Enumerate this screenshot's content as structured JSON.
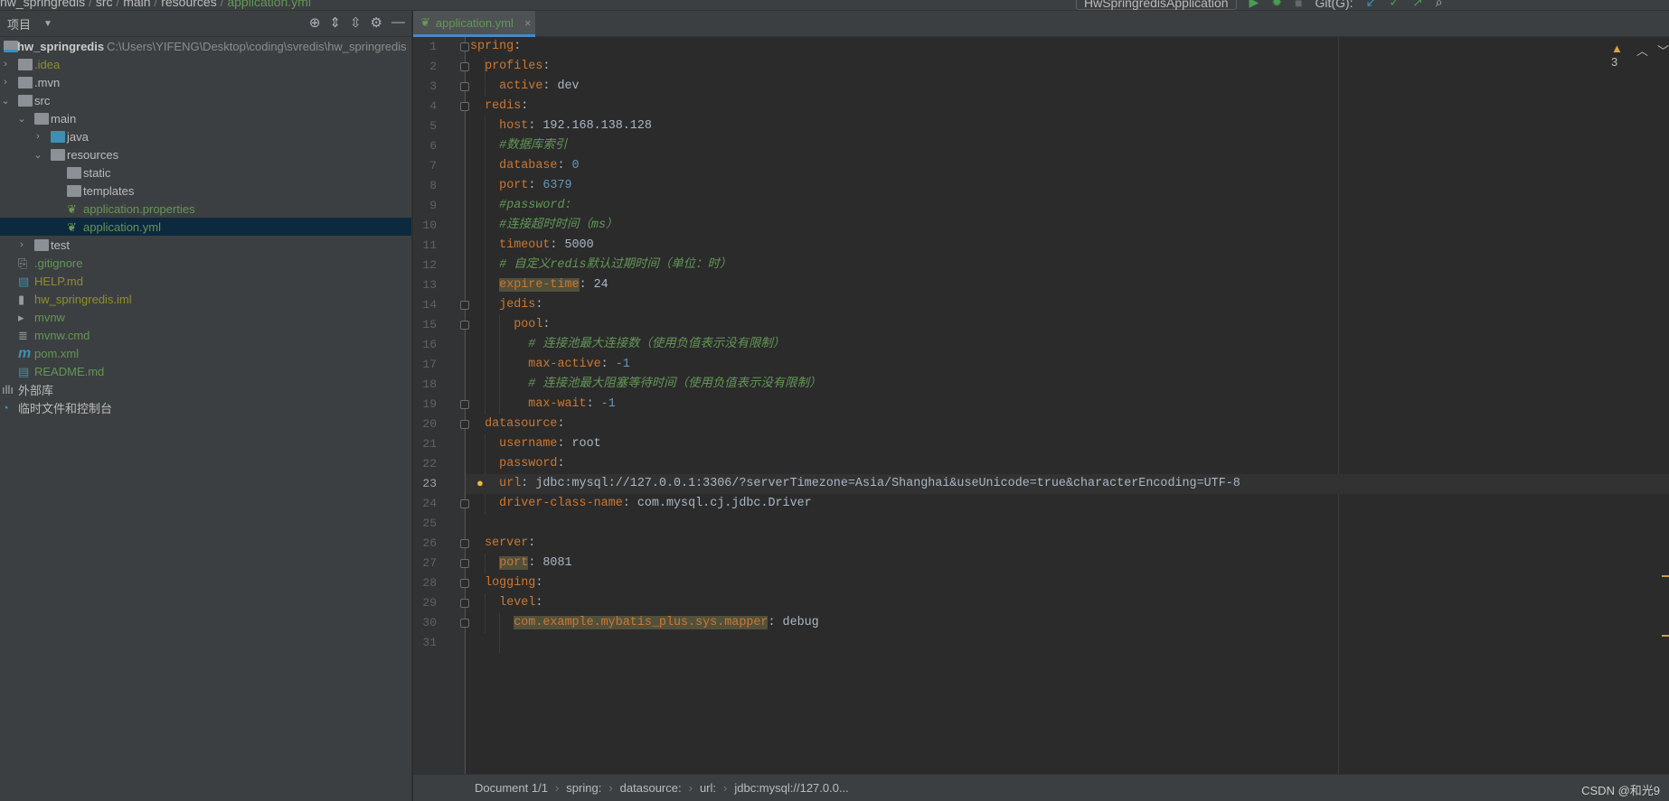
{
  "topbar": {
    "breadcrumb": [
      "hw_springredis",
      "src",
      "main",
      "resources",
      "application.yml"
    ],
    "run_config": "HwSpringredisApplication",
    "git_label": "Git(G):"
  },
  "project": {
    "title": "项目",
    "root_name": "hw_springredis",
    "root_path": "C:\\Users\\YIFENG\\Desktop\\coding\\svredis\\hw_springredis",
    "items": [
      {
        "label": ".idea",
        "depth": 0,
        "chev": ">",
        "icon": "folder-icon",
        "color": "olive"
      },
      {
        "label": ".mvn",
        "depth": 0,
        "chev": ">",
        "icon": "folder-icon",
        "color": "def"
      },
      {
        "label": "src",
        "depth": 0,
        "chev": "v",
        "icon": "folder-icon",
        "color": "def"
      },
      {
        "label": "main",
        "depth": 1,
        "chev": "v",
        "icon": "folder-icon",
        "color": "def"
      },
      {
        "label": "java",
        "depth": 2,
        "chev": ">",
        "icon": "source-folder-icon",
        "color": "def"
      },
      {
        "label": "resources",
        "depth": 2,
        "chev": "v",
        "icon": "resources-folder-icon",
        "color": "def"
      },
      {
        "label": "static",
        "depth": 3,
        "chev": "",
        "icon": "folder-icon",
        "color": "def"
      },
      {
        "label": "templates",
        "depth": 3,
        "chev": "",
        "icon": "folder-icon",
        "color": "def"
      },
      {
        "label": "application.properties",
        "depth": 3,
        "chev": "",
        "icon": "spring-config-icon",
        "color": "green"
      },
      {
        "label": "application.yml",
        "depth": 3,
        "chev": "",
        "icon": "spring-config-icon",
        "color": "green",
        "selected": true
      },
      {
        "label": "test",
        "depth": 1,
        "chev": ">",
        "icon": "folder-icon",
        "color": "def"
      },
      {
        "label": ".gitignore",
        "depth": 0,
        "chev": "",
        "icon": "gitignore-file-icon",
        "color": "green"
      },
      {
        "label": "HELP.md",
        "depth": 0,
        "chev": "",
        "icon": "markdown-file-icon",
        "color": "olive"
      },
      {
        "label": "hw_springredis.iml",
        "depth": 0,
        "chev": "",
        "icon": "iml-file-icon",
        "color": "olive"
      },
      {
        "label": "mvnw",
        "depth": 0,
        "chev": "",
        "icon": "shell-script-icon",
        "color": "green"
      },
      {
        "label": "mvnw.cmd",
        "depth": 0,
        "chev": "",
        "icon": "text-file-icon",
        "color": "green"
      },
      {
        "label": "pom.xml",
        "depth": 0,
        "chev": "",
        "icon": "maven-icon",
        "color": "green"
      },
      {
        "label": "README.md",
        "depth": 0,
        "chev": "",
        "icon": "markdown-file-icon",
        "color": "green"
      },
      {
        "label": "外部库",
        "depth": -1,
        "chev": "",
        "icon": "library-icon",
        "color": "def"
      },
      {
        "label": "临时文件和控制台",
        "depth": -1,
        "chev": "",
        "icon": "scratches-icon",
        "color": "def"
      }
    ]
  },
  "editor": {
    "tab_label": "application.yml",
    "warnings": "3",
    "current_line": 23,
    "lines": [
      [
        [
          "k",
          "spring"
        ],
        [
          "v",
          ":"
        ]
      ],
      [
        [
          "s",
          "  "
        ],
        [
          "k",
          "profiles"
        ],
        [
          "v",
          ":"
        ]
      ],
      [
        [
          "s",
          "    "
        ],
        [
          "k",
          "active"
        ],
        [
          "v",
          ": dev"
        ]
      ],
      [
        [
          "s",
          "  "
        ],
        [
          "k",
          "redis"
        ],
        [
          "v",
          ":"
        ]
      ],
      [
        [
          "s",
          "    "
        ],
        [
          "k",
          "host"
        ],
        [
          "v",
          ": 192.168.138.128"
        ]
      ],
      [
        [
          "s",
          "    "
        ],
        [
          "cm",
          "#数据库索引"
        ]
      ],
      [
        [
          "s",
          "    "
        ],
        [
          "k",
          "database"
        ],
        [
          "v",
          ": "
        ],
        [
          "n",
          "0"
        ]
      ],
      [
        [
          "s",
          "    "
        ],
        [
          "k",
          "port"
        ],
        [
          "v",
          ": "
        ],
        [
          "n",
          "6379"
        ]
      ],
      [
        [
          "s",
          "    "
        ],
        [
          "cm",
          "#password:"
        ]
      ],
      [
        [
          "s",
          "    "
        ],
        [
          "cm",
          "#连接超时时间（ms）"
        ]
      ],
      [
        [
          "s",
          "    "
        ],
        [
          "k",
          "timeout"
        ],
        [
          "v",
          ": 5000"
        ]
      ],
      [
        [
          "s",
          "    "
        ],
        [
          "cm",
          "# 自定义redis默认过期时间（单位：时）"
        ]
      ],
      [
        [
          "s",
          "    "
        ],
        [
          "hk",
          "expire-time"
        ],
        [
          "v",
          ": 24"
        ]
      ],
      [
        [
          "s",
          "    "
        ],
        [
          "k",
          "jedis"
        ],
        [
          "v",
          ":"
        ]
      ],
      [
        [
          "s",
          "      "
        ],
        [
          "k",
          "pool"
        ],
        [
          "v",
          ":"
        ]
      ],
      [
        [
          "s",
          "        "
        ],
        [
          "cm",
          "# 连接池最大连接数（使用负值表示没有限制）"
        ]
      ],
      [
        [
          "s",
          "        "
        ],
        [
          "k",
          "max-active"
        ],
        [
          "v",
          ": "
        ],
        [
          "n",
          "-1"
        ]
      ],
      [
        [
          "s",
          "        "
        ],
        [
          "cm",
          "# 连接池最大阻塞等待时间（使用负值表示没有限制）"
        ]
      ],
      [
        [
          "s",
          "        "
        ],
        [
          "k",
          "max-wait"
        ],
        [
          "v",
          ": "
        ],
        [
          "n",
          "-1"
        ]
      ],
      [
        [
          "s",
          "  "
        ],
        [
          "k",
          "datasource"
        ],
        [
          "v",
          ":"
        ]
      ],
      [
        [
          "s",
          "    "
        ],
        [
          "k",
          "username"
        ],
        [
          "v",
          ": root"
        ]
      ],
      [
        [
          "s",
          "    "
        ],
        [
          "k",
          "password"
        ],
        [
          "v",
          ":"
        ]
      ],
      [
        [
          "s",
          "    "
        ],
        [
          "k",
          "url"
        ],
        [
          "v",
          ": jdbc:mysql://127.0.0.1:3306/?serverTimezone=Asia/Shanghai&useUnicode=true&characterEncoding=UTF-8"
        ]
      ],
      [
        [
          "s",
          "    "
        ],
        [
          "k",
          "driver-class-name"
        ],
        [
          "v",
          ": com.mysql.cj.jdbc.Driver"
        ]
      ],
      [],
      [
        [
          "s",
          "  "
        ],
        [
          "k",
          "server"
        ],
        [
          "v",
          ":"
        ]
      ],
      [
        [
          "s",
          "    "
        ],
        [
          "hk",
          "port"
        ],
        [
          "v",
          ": 8081"
        ]
      ],
      [
        [
          "s",
          "  "
        ],
        [
          "k",
          "logging"
        ],
        [
          "v",
          ":"
        ]
      ],
      [
        [
          "s",
          "    "
        ],
        [
          "k",
          "level"
        ],
        [
          "v",
          ":"
        ]
      ],
      [
        [
          "s",
          "      "
        ],
        [
          "hk",
          "com.example.mybatis_plus.sys.mapper"
        ],
        [
          "v",
          ": debug"
        ]
      ],
      []
    ],
    "folds": [
      1,
      2,
      3,
      4,
      14,
      15,
      19,
      20,
      24,
      26,
      27,
      28,
      29,
      30
    ]
  },
  "statusbar": {
    "crumbs": [
      "Document 1/1",
      "spring:",
      "datasource:",
      "url:",
      "jdbc:mysql://127.0.0..."
    ],
    "watermark": "CSDN @和光9"
  },
  "colors": {
    "key": "#cc7832",
    "value": "#a9b7c6",
    "number": "#6897bb",
    "comment": "#629755",
    "selection": "#0d293e",
    "accent": "#4a88c7"
  }
}
